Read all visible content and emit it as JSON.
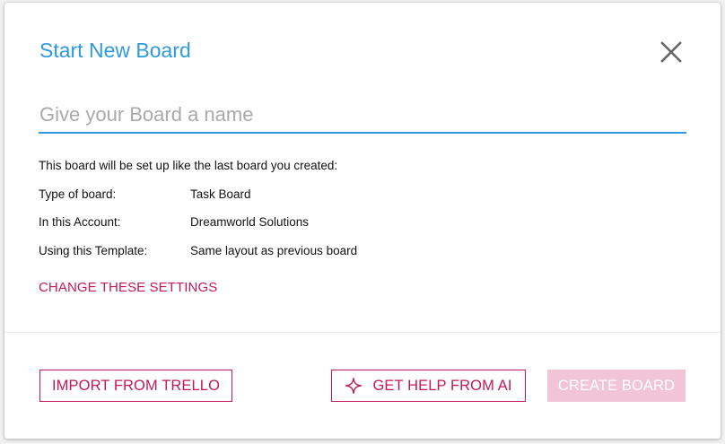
{
  "dialog": {
    "title": "Start New Board",
    "name_input": {
      "value": "",
      "placeholder": "Give your Board a name"
    },
    "intro_text": "This board will be set up like the last board you created:",
    "settings": [
      {
        "label": "Type of board:",
        "value": "Task Board"
      },
      {
        "label": "In this Account:",
        "value": "Dreamworld Solutions"
      },
      {
        "label": "Using this Template:",
        "value": "Same layout as previous board"
      }
    ],
    "change_settings_label": "CHANGE THESE SETTINGS",
    "buttons": {
      "import_label": "IMPORT FROM TRELLO",
      "ai_label": "GET HELP FROM AI",
      "create_label": "CREATE BOARD"
    }
  },
  "icons": {
    "close": "close-icon",
    "ai": "sparkle-icon"
  },
  "colors": {
    "title": "#2e9be0",
    "accent": "#c2185b",
    "create_disabled_bg": "#f1c4d6",
    "input_underline": "#2e9be0"
  }
}
